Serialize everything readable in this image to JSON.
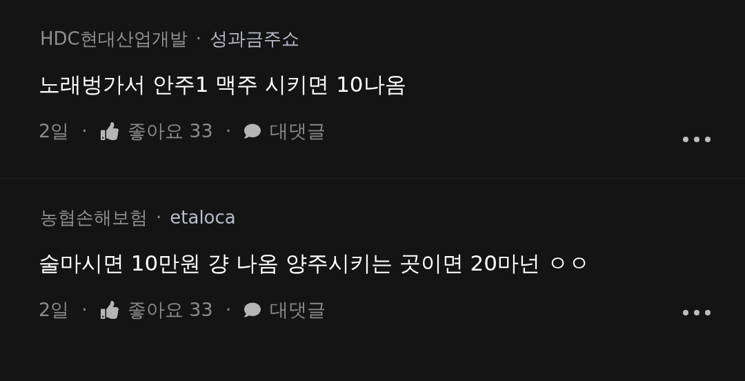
{
  "comments": [
    {
      "author": {
        "company": "HDC현대산업개발",
        "separator": "·",
        "nickname": "성과금주쇼"
      },
      "text": "노래벙가서 안주1 맥주 시키면 10나옴",
      "meta": [
        {
          "kind": "time",
          "text": "2일"
        },
        {
          "kind": "dot",
          "text": "·"
        },
        {
          "kind": "like",
          "text": "좋아요 33"
        },
        {
          "kind": "dot",
          "text": "·"
        },
        {
          "kind": "reply",
          "text": "대댓글"
        }
      ]
    },
    {
      "author": {
        "company": "농협손해보험",
        "separator": "·",
        "nickname": "etaloca"
      },
      "text": "술마시면 10만원 걍 나옴 양주시키는 곳이면 20마넌 ㅇㅇ",
      "meta": [
        {
          "kind": "time",
          "text": "2일"
        },
        {
          "kind": "dot",
          "text": "·"
        },
        {
          "kind": "like",
          "text": "좋아요 33"
        },
        {
          "kind": "dot",
          "text": "·"
        },
        {
          "kind": "reply",
          "text": "대댓글"
        }
      ]
    }
  ]
}
